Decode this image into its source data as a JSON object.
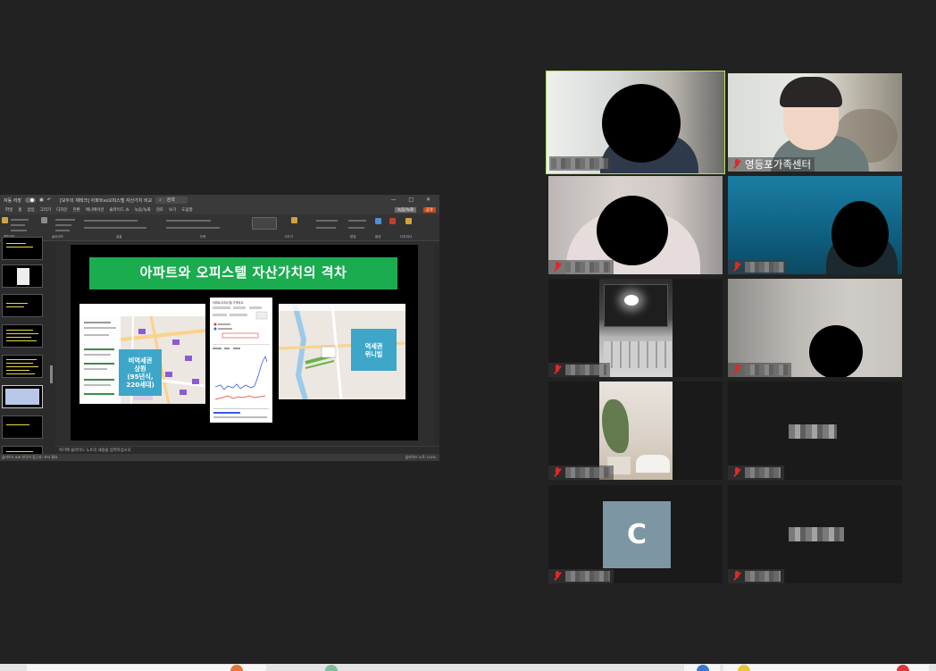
{
  "powerpoint": {
    "title_bar_left": "자동 저장",
    "title_bar_doc": "[모두의 재테크] 아파트vs오피스텔 자산가치 비교",
    "search_label": "검색",
    "window_buttons": "— □ ✕",
    "menu": [
      "파일",
      "홈",
      "삽입",
      "그리기",
      "디자인",
      "전환",
      "애니메이션",
      "슬라이드 쇼",
      "녹음/녹화",
      "검토",
      "보기",
      "도움말"
    ],
    "record_button": "녹음/녹화",
    "share_button": "공유",
    "ribbon_groups": [
      "클립보드",
      "슬라이드",
      "글꼴",
      "단락",
      "그리기",
      "편집",
      "음성",
      "디자이너"
    ],
    "slide_count": 8,
    "active_slide": 6,
    "notes_placeholder": "여기에 슬라이드 노트의 내용을 입력하십시오",
    "status_left": "슬라이드 6/8   한국어   접근성: 조사 필요",
    "status_right": "슬라이드 노트   110%"
  },
  "slide": {
    "title": "아파트와 오피스텔 자산가치의 격차",
    "left_label": "비역세권\n상원\n(95년식,\n220세대)",
    "right_label": "역세권\n위니빌",
    "mid_panel_title": "아파트/오피스텔 가격비교"
  },
  "gallery": {
    "tiles": [
      {
        "id": "t1",
        "name": "",
        "muted": false,
        "active": true
      },
      {
        "id": "t2",
        "name": "영등포가족센터",
        "muted": true,
        "active": false
      },
      {
        "id": "t3",
        "name": "",
        "muted": true,
        "active": false
      },
      {
        "id": "t4",
        "name": "",
        "muted": true,
        "active": false
      },
      {
        "id": "t5",
        "name": "",
        "muted": true,
        "active": false
      },
      {
        "id": "t6",
        "name": "",
        "muted": true,
        "active": false
      },
      {
        "id": "t7",
        "name": "",
        "muted": true,
        "active": false
      },
      {
        "id": "t8",
        "name": "",
        "muted": true,
        "active": false
      },
      {
        "id": "t9",
        "name": "",
        "muted": true,
        "active": false,
        "avatar": "C"
      },
      {
        "id": "t10",
        "name": "",
        "muted": true,
        "active": false
      }
    ]
  },
  "colors": {
    "background": "#222222",
    "active_speaker_border": "#b5e361",
    "slide_title_bg": "#1aac4f",
    "label_box_bg": "#3ea6c8",
    "avatar_bg": "#7c96a3",
    "muted_icon": "#e02828"
  }
}
